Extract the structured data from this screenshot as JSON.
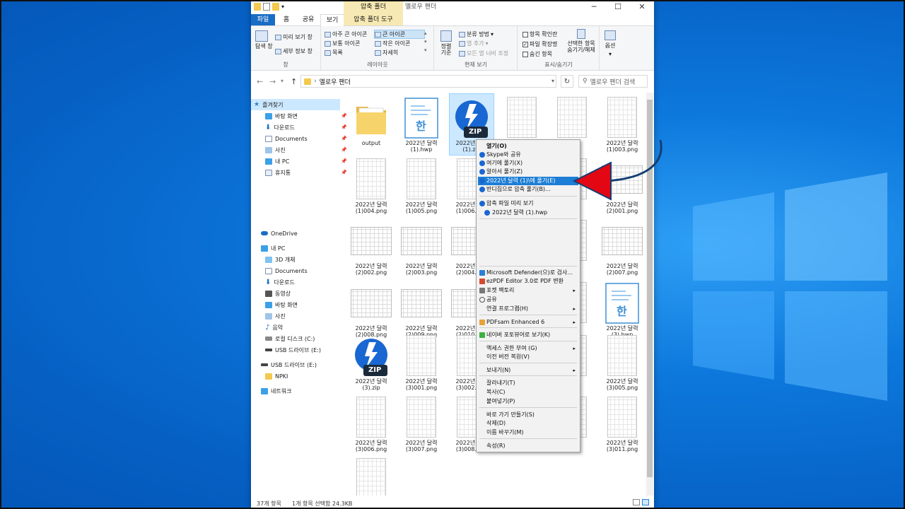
{
  "explorer": {
    "title": "옐로우 팬더",
    "context_tab_header": "압축 폴더",
    "tabs": [
      {
        "label": "파일"
      },
      {
        "label": "홈"
      },
      {
        "label": "공유"
      },
      {
        "label": "보기"
      },
      {
        "label": "압축 폴더 도구"
      }
    ]
  },
  "ribbon": {
    "pane": {
      "nav_pane": "탐색 창",
      "preview": "미리 보기 창",
      "details": "세부 정보 창",
      "label": "창"
    },
    "layout": {
      "items": [
        "아주 큰 아이콘",
        "큰 아이콘",
        "보통 아이콘",
        "작은 아이콘",
        "목록",
        "자세히"
      ],
      "label": "레이아웃"
    },
    "current_view": {
      "sort": "정렬 기준",
      "group_by": "분류 방법",
      "add_col": "열 추가",
      "fit_cols": "모든 열 너비 조정",
      "label": "현재 보기"
    },
    "show_hide": {
      "item_check": "항목 확인란",
      "file_ext": "파일 확장명",
      "hidden": "숨긴 항목",
      "hide_selected": "선택한 항목 숨기기/해제",
      "label": "표시/숨기기"
    },
    "options": "옵션"
  },
  "address": {
    "path": "옐로우 팬더",
    "search_placeholder": "옐로우 팬더 검색"
  },
  "nav": {
    "quick_access": "즐겨찾기",
    "quick_items": [
      "바탕 화면",
      "다운로드",
      "Documents",
      "사진",
      "내 PC",
      "휴지통"
    ],
    "onedrive": "OneDrive",
    "this_pc": "내 PC",
    "pc_items": [
      "3D 개체",
      "Documents",
      "다운로드",
      "동영상",
      "바탕 화면",
      "사진",
      "음악",
      "로컬 디스크 (C:)",
      "USB 드라이브 (E:)"
    ],
    "usb": "USB 드라이브 (E:)",
    "usb_items": [
      "NPKI"
    ],
    "network": "네트워크"
  },
  "files": [
    "output",
    "2022년 달력 (1).hwp",
    "2022년 달력 (1).zip",
    "",
    "",
    "2022년 달력 (1)003.png",
    "2022년 달력 (1)004.png",
    "2022년 달력 (1)005.png",
    "2022년 달력 (1)006.png",
    "",
    "",
    "2022년 달력 (2)001.png",
    "2022년 달력 (2)002.png",
    "2022년 달력 (2)003.png",
    "2022년 달력 (2)004.png",
    "",
    "",
    "2022년 달력 (2)007.png",
    "2022년 달력 (2)008.png",
    "2022년 달력 (2)009.png",
    "2022년 달력 (2)010.png",
    "",
    "",
    "2022년 달력 (3).hwp",
    "2022년 달력 (3).zip",
    "2022년 달력 (3)001.png",
    "2022년 달력 (3)002.png",
    "",
    "",
    "2022년 달력 (3)005.png",
    "2022년 달력 (3)006.png",
    "2022년 달력 (3)007.png",
    "2022년 달력 (3)008.png",
    "",
    "",
    "2022년 달력 (3)011.png",
    ""
  ],
  "zip_label": "ZIP",
  "hwp_label": "한",
  "status": {
    "count": "37개 항목",
    "selected": "1개 항목 선택함 24.3KB"
  },
  "context_menu": {
    "items": [
      "열기(O)",
      "Skype와 공유",
      "여기에 풀기(X)",
      "알아서 풀기(Z)",
      "2022년 달력 (1)\\에 풀기(E)",
      "반디집으로 압축 풀기(B)...",
      "압축 파일 미리 보기",
      "2022년 달력 (1).hwp",
      "Microsoft Defender(으)로 검사...",
      "ezPDF Editor 3.0로 PDF 변환",
      "포켓 팩토리",
      "공유",
      "연결 프로그램(H)",
      "PDFsam Enhanced 6",
      "네이버 포토뷰어로 보기(K)",
      "액세스 권한 부여 (G)",
      "이전 버전 복원(V)",
      "보내기(N)",
      "잘라내기(T)",
      "복사(C)",
      "붙여넣기(P)",
      "바로 가기 만들기(S)",
      "삭제(D)",
      "이름 바꾸기(M)",
      "속성(R)"
    ]
  },
  "colors": {
    "accent": "#1c7ed6",
    "file_tab": "#1a6dc4",
    "ctx_tab": "#f7e9b3",
    "zip_blue": "#1967d2",
    "arrow_red": "#e30613"
  }
}
